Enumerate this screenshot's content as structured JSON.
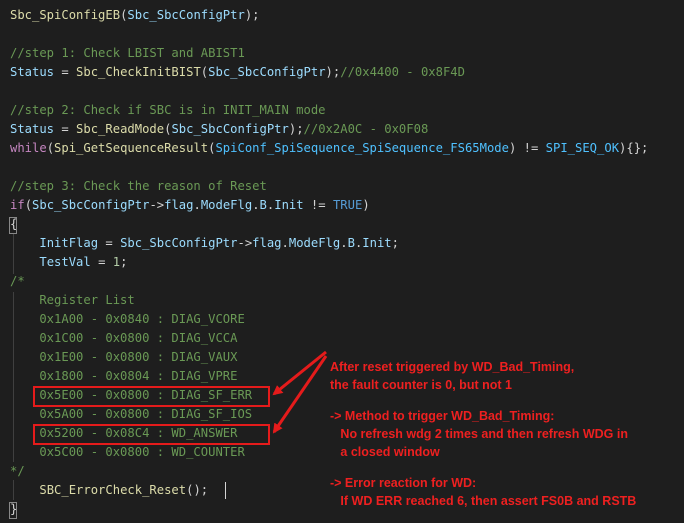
{
  "code": {
    "l1_fn": "Sbc_SpiConfigEB",
    "l1_arg": "Sbc_SbcConfigPtr",
    "step1_comment": "//step 1: Check LBIST and ABIST1",
    "l3_var": "Status",
    "l3_fn": "Sbc_CheckInitBIST",
    "l3_arg": "Sbc_SbcConfigPtr",
    "l3_comment": "//0x4400 - 0x8F4D",
    "step2_comment": "//step 2: Check if SBC is in INIT_MAIN mode",
    "l6_var": "Status",
    "l6_fn": "Sbc_ReadMode",
    "l6_arg": "Sbc_SbcConfigPtr",
    "l6_comment": "//0x2A0C - 0x0F08",
    "l7_kw": "while",
    "l7_fn": "Spi_GetSequenceResult",
    "l7_arg": "SpiConf_SpiSequence_SpiSequence_FS65Mode",
    "l7_const": "SPI_SEQ_OK",
    "step3_comment": "//step 3: Check the reason of Reset",
    "l10_kw": "if",
    "l10_var1": "Sbc_SbcConfigPtr",
    "l10_var2": "flag",
    "l10_var3": "ModeFlg",
    "l10_var4": "B",
    "l10_var5": "Init",
    "l10_const": "TRUE",
    "l12_var1": "InitFlag",
    "l12_var2": "Sbc_SbcConfigPtr",
    "l12_var3": "flag",
    "l12_var4": "ModeFlg",
    "l12_var5": "B",
    "l12_var6": "Init",
    "l13_var": "TestVal",
    "l13_num": "1",
    "comment_open": "/*",
    "register_list": "    Register List",
    "registers": [
      "    0x1A00 - 0x0840 : DIAG_VCORE",
      "    0x1C00 - 0x0800 : DIAG_VCCA",
      "    0x1E00 - 0x0800 : DIAG_VAUX",
      "    0x1800 - 0x0804 : DIAG_VPRE",
      "    0x5E00 - 0x0800 : DIAG_SF_ERR",
      "    0x5A00 - 0x0800 : DIAG_SF_IOS",
      "    0x5200 - 0x08C4 : WD_ANSWER",
      "    0x5C00 - 0x0800 : WD_COUNTER"
    ],
    "comment_close": "*/",
    "l26_fn": "SBC_ErrorCheck_Reset"
  },
  "annotations": {
    "a1_line1": "After reset triggered by WD_Bad_Timing,",
    "a1_line2": "the fault counter is 0, but not 1",
    "a2_line1": "-> Method to trigger WD_Bad_Timing:",
    "a2_line2": "   No refresh wdg 2 times and then refresh WDG in",
    "a2_line3": "   a closed window",
    "a3_line1": "-> Error reaction for WD:",
    "a3_line2": "   If WD ERR reached 6, then assert FS0B and RSTB"
  },
  "colors": {
    "background": "#1e1e1e",
    "annotation": "#ee2020",
    "function": "#dcdcaa",
    "variable": "#9cdcfe",
    "comment": "#6a9955",
    "keyword": "#c586c0",
    "constant": "#4fc1ff"
  }
}
